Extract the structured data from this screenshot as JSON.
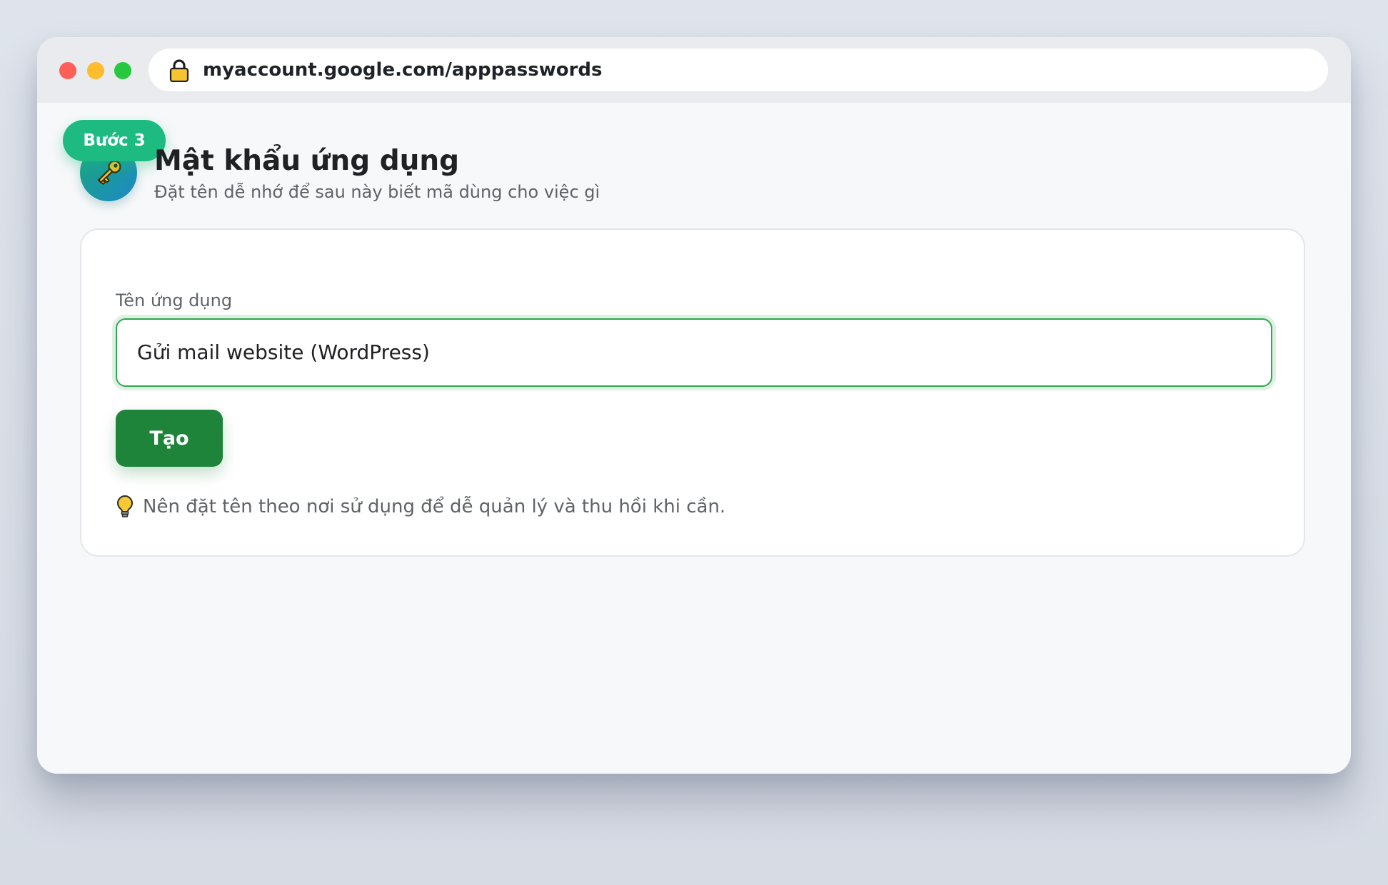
{
  "browser": {
    "url": "myaccount.google.com/apppasswords"
  },
  "header": {
    "step_badge": "Bước 3",
    "title": "Mật khẩu ứng dụng",
    "subtitle": "Đặt tên dễ nhớ để sau này biết mã dùng cho việc gì",
    "icon": "key-icon"
  },
  "form": {
    "label": "Tên ứng dụng",
    "value": "Gửi mail website (WordPress)",
    "create_button": "Tạo",
    "hint": "Nên đặt tên theo nơi sử dụng để dễ quản lý và thu hồi khi cần.",
    "hint_icon": "lightbulb-icon"
  },
  "colors": {
    "accent_green": "#1e843a",
    "badge_green": "#1dbb82",
    "focus_border": "#2fa84f"
  }
}
